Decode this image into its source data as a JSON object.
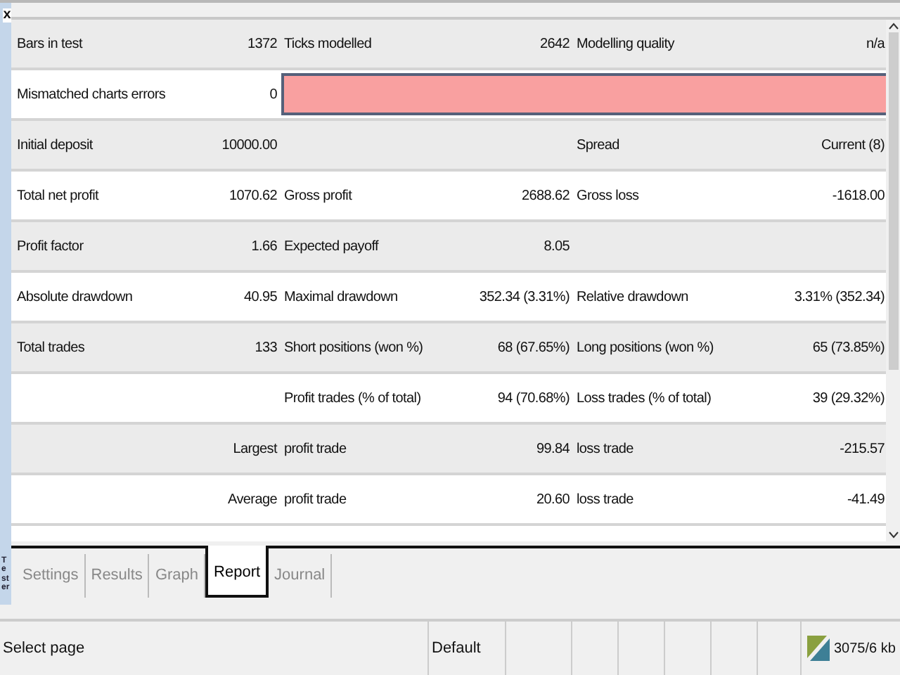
{
  "panel": {
    "title": "Tester",
    "close": "x"
  },
  "report": {
    "rows": [
      {
        "kind": "text",
        "label_1": "Bars in test",
        "value_1": "1372",
        "label_2": "Ticks modelled",
        "value_2": "2642",
        "label_3": "Modelling quality",
        "value_3": "n/a"
      },
      {
        "kind": "quality_bar",
        "label_1": "Mismatched charts errors",
        "value_1": "0"
      },
      {
        "kind": "text",
        "label_1": "Initial deposit",
        "value_1": "10000.00",
        "label_3": "Spread",
        "value_3": "Current (8)"
      },
      {
        "kind": "text",
        "label_1": "Total net profit",
        "value_1": "1070.62",
        "label_2": "Gross profit",
        "value_2": "2688.62",
        "label_3": "Gross loss",
        "value_3": "-1618.00"
      },
      {
        "kind": "text",
        "label_1": "Profit factor",
        "value_1": "1.66",
        "label_2": "Expected payoff",
        "value_2": "8.05"
      },
      {
        "kind": "text",
        "label_1": "Absolute drawdown",
        "value_1": "40.95",
        "label_2": "Maximal drawdown",
        "value_2": "352.34 (3.31%)",
        "label_3": "Relative drawdown",
        "value_3": "3.31% (352.34)"
      },
      {
        "kind": "text",
        "label_1": "Total trades",
        "value_1": "133",
        "label_2": "Short positions (won %)",
        "value_2": "68 (67.65%)",
        "label_3": "Long positions (won %)",
        "value_3": "65 (73.85%)"
      },
      {
        "kind": "text",
        "label_2": "Profit trades (% of total)",
        "value_2": "94 (70.68%)",
        "label_3": "Loss trades (% of total)",
        "value_3": "39 (29.32%)"
      },
      {
        "kind": "text",
        "value_1": "Largest",
        "label_2": "profit trade",
        "value_2": "99.84",
        "label_3": "loss trade",
        "value_3": "-215.57"
      },
      {
        "kind": "text",
        "value_1": "Average",
        "label_2": "profit trade",
        "value_2": "20.60",
        "label_3": "loss trade",
        "value_3": "-41.49"
      }
    ]
  },
  "tabs": [
    {
      "label": "Settings",
      "selected": false
    },
    {
      "label": "Results",
      "selected": false
    },
    {
      "label": "Graph",
      "selected": false
    },
    {
      "label": "Report",
      "selected": true
    },
    {
      "label": "Journal",
      "selected": false
    }
  ],
  "status_bar": {
    "hint": "Select page",
    "profile": "Default",
    "traffic": "3075/6 kb"
  }
}
